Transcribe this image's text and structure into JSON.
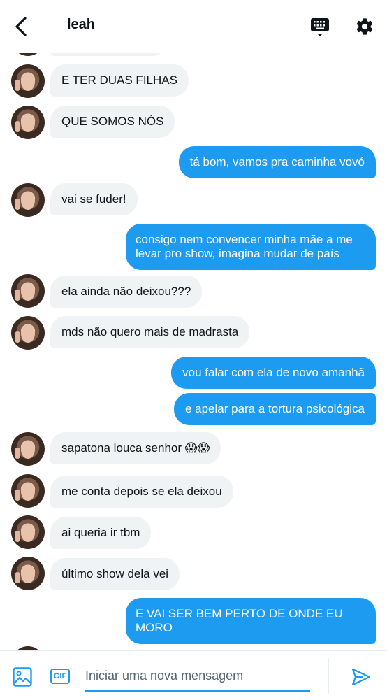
{
  "header": {
    "title": "leah",
    "icons": {
      "back": "back-arrow-icon",
      "keyboard": "keyboard-icon",
      "settings": "gear-icon"
    }
  },
  "messages": [
    {
      "side": "received",
      "text": "E TER DUAS FILHAS"
    },
    {
      "side": "received",
      "text": "QUE SOMOS NÓS"
    },
    {
      "side": "sent",
      "text": "tá bom, vamos pra caminha vovó"
    },
    {
      "side": "received",
      "text": "vai se fuder!"
    },
    {
      "side": "sent",
      "text": "consigo nem convencer minha mãe a me levar pro show, imagina mudar de país"
    },
    {
      "side": "received",
      "text": "ela ainda não deixou???"
    },
    {
      "side": "received",
      "text": "mds não quero mais de madrasta"
    },
    {
      "side": "sent",
      "text": "vou falar com ela de novo amanhã"
    },
    {
      "side": "sent",
      "text": "e apelar para a tortura psicológica"
    },
    {
      "side": "received",
      "text": "sapatona louca senhor 😱😱"
    },
    {
      "side": "received",
      "text": "me conta depois se ela deixou"
    },
    {
      "side": "received",
      "text": "ai queria ir tbm"
    },
    {
      "side": "received",
      "text": "último show dela vei"
    },
    {
      "side": "sent",
      "text": "E VAI SER BEM PERTO DE ONDE EU MORO"
    }
  ],
  "composer": {
    "placeholder": "Iniciar uma nova mensagem",
    "gif_label": "GIF",
    "icons": {
      "image": "image-icon",
      "gif": "gif-icon",
      "send": "send-icon"
    }
  },
  "colors": {
    "accent": "#1d9bf0",
    "received_bubble": "#eff3f4",
    "text": "#0f1419"
  }
}
